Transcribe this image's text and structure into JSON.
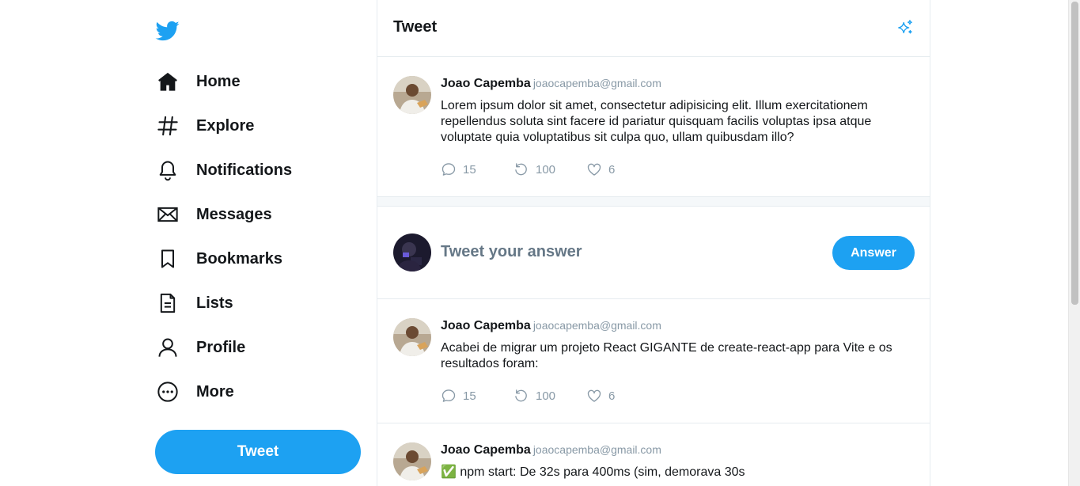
{
  "sidebar": {
    "logo_icon": "twitter-bird-icon",
    "items": [
      {
        "label": "Home",
        "icon": "home-icon"
      },
      {
        "label": "Explore",
        "icon": "hashtag-icon"
      },
      {
        "label": "Notifications",
        "icon": "bell-icon"
      },
      {
        "label": "Messages",
        "icon": "envelope-icon"
      },
      {
        "label": "Bookmarks",
        "icon": "bookmark-icon"
      },
      {
        "label": "Lists",
        "icon": "list-document-icon"
      },
      {
        "label": "Profile",
        "icon": "user-icon"
      },
      {
        "label": "More",
        "icon": "more-circle-icon"
      }
    ],
    "tweet_button": "Tweet"
  },
  "header": {
    "title": "Tweet",
    "sparkle_icon": "sparkle-icon"
  },
  "main_tweet": {
    "author": "Joao Capemba",
    "email": "joaocapemba@gmail.com",
    "text": "Lorem ipsum dolor sit amet, consectetur adipisicing elit. Illum exercitationem repellendus soluta sint facere id pariatur quisquam facilis voluptas ipsa atque voluptate quia voluptatibus sit culpa quo, ullam quibusdam illo?",
    "replies": "15",
    "retweets": "100",
    "likes": "6"
  },
  "compose": {
    "placeholder": "Tweet your answer",
    "button": "Answer"
  },
  "replies": [
    {
      "author": "Joao Capemba",
      "email": "joaocapemba@gmail.com",
      "text": "Acabei de migrar um projeto React GIGANTE de create-react-app para Vite e os resultados foram:",
      "replies": "15",
      "retweets": "100",
      "likes": "6"
    },
    {
      "author": "Joao Capemba",
      "email": "joaocapemba@gmail.com",
      "text": "✅ npm start: De 32s para 400ms (sim, demorava 30s"
    }
  ],
  "colors": {
    "accent": "#1da1f2",
    "muted": "#8899a6",
    "border": "#e6ecf0"
  }
}
